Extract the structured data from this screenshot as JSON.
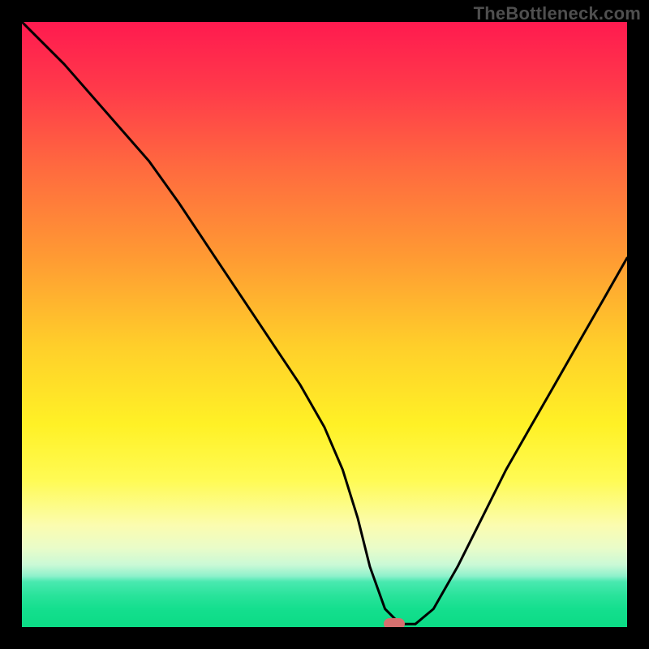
{
  "watermark": "TheBottleneck.com",
  "colors": {
    "frame": "#000000",
    "curve": "#000000",
    "marker": "#d6706f",
    "gradient_top": "#ff1a4f",
    "gradient_bottom": "#0bdb85"
  },
  "chart_data": {
    "type": "line",
    "title": "",
    "xlabel": "",
    "ylabel": "",
    "xlim": [
      0,
      100
    ],
    "ylim": [
      0,
      100
    ],
    "x": [
      0,
      7,
      14,
      21,
      26,
      30,
      34,
      38,
      42,
      46,
      50,
      53,
      55.5,
      57.5,
      60,
      62.5,
      65,
      68,
      72,
      76,
      80,
      84,
      88,
      92,
      96,
      100
    ],
    "values": [
      100,
      93,
      85,
      77,
      70,
      64,
      58,
      52,
      46,
      40,
      33,
      26,
      18,
      10,
      3,
      0.5,
      0.5,
      3,
      10,
      18,
      26,
      33,
      40,
      47,
      54,
      61
    ],
    "marker": {
      "x": 61.5,
      "y": 0.6
    },
    "notes": "V-shaped bottleneck curve over rainbow severity gradient; minimum (optimal) near x≈61.5. No axis ticks or numeric labels visible."
  }
}
